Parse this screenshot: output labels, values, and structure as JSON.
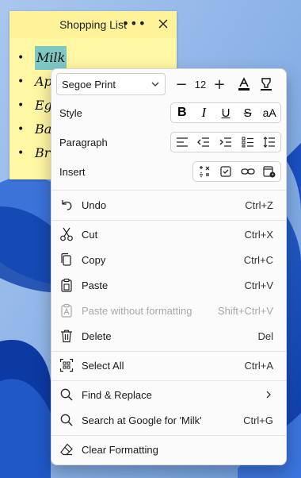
{
  "note": {
    "title": "Shopping List",
    "items": [
      {
        "text": "Milk",
        "selected": true
      },
      {
        "text": "Ap"
      },
      {
        "text": "Eg"
      },
      {
        "text": "Ba"
      },
      {
        "text": "Br"
      }
    ],
    "bullet": "•"
  },
  "menu": {
    "font_name": "Segoe Print",
    "font_size": "12",
    "minus": "−",
    "plus": "+",
    "style_label": "Style",
    "paragraph_label": "Paragraph",
    "insert_label": "Insert",
    "style_change_case": "aA",
    "items": {
      "undo": {
        "label": "Undo",
        "shortcut": "Ctrl+Z"
      },
      "cut": {
        "label": "Cut",
        "shortcut": "Ctrl+X"
      },
      "copy": {
        "label": "Copy",
        "shortcut": "Ctrl+C"
      },
      "paste": {
        "label": "Paste",
        "shortcut": "Ctrl+V"
      },
      "paste_plain": {
        "label": "Paste without formatting",
        "shortcut": "Shift+Ctrl+V"
      },
      "delete": {
        "label": "Delete",
        "shortcut": "Del"
      },
      "select_all": {
        "label": "Select All",
        "shortcut": "Ctrl+A"
      },
      "find_replace": {
        "label": "Find & Replace"
      },
      "search_google": {
        "label": "Search at Google for 'Milk'",
        "shortcut": "Ctrl+G"
      },
      "clear_formatting": {
        "label": "Clear Formatting"
      }
    }
  },
  "colors": {
    "note_bg": "#fff7a3",
    "selection": "#7ec7c3",
    "menu_bg": "#fbfbfb"
  }
}
